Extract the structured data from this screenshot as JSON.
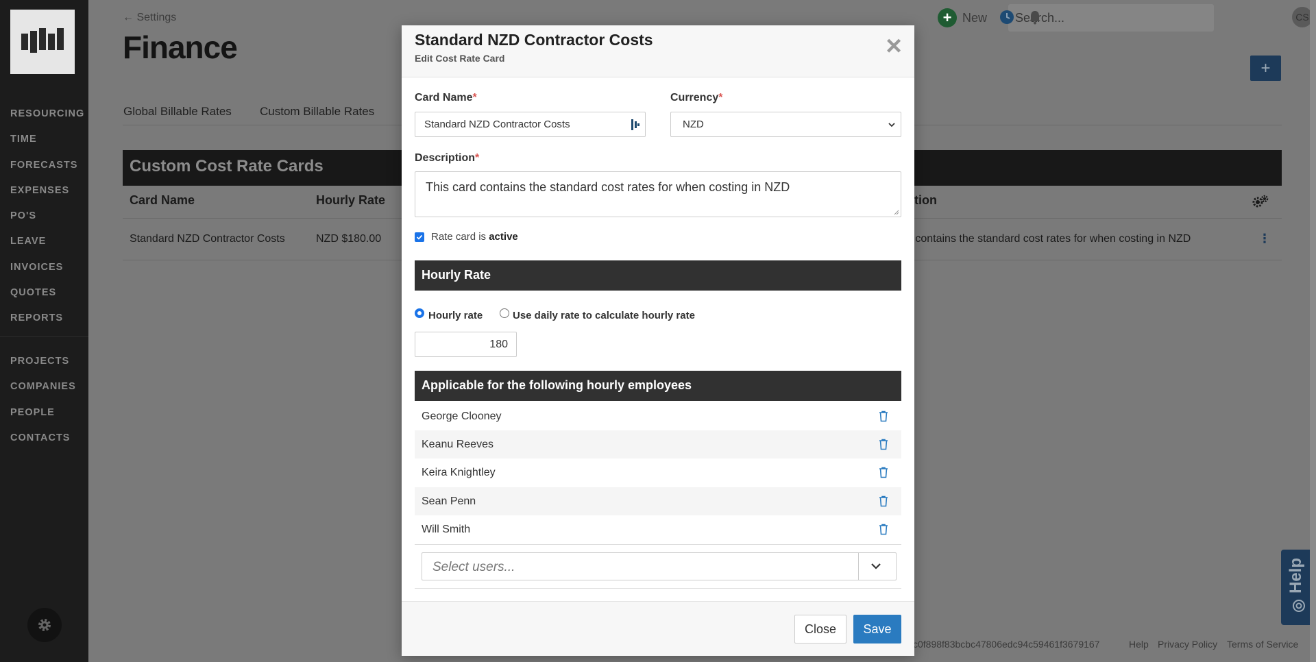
{
  "sidebar": {
    "nav_primary": [
      "RESOURCING",
      "TIME",
      "FORECASTS",
      "EXPENSES",
      "PO'S",
      "LEAVE",
      "INVOICES",
      "QUOTES",
      "REPORTS"
    ],
    "nav_secondary": [
      "PROJECTS",
      "COMPANIES",
      "PEOPLE",
      "CONTACTS"
    ]
  },
  "header": {
    "back_label": "← Settings",
    "page_title": "Finance",
    "new_label": "New",
    "search_placeholder": "Search...",
    "avatar_initials": "CS"
  },
  "tabs": [
    "Global Billable Rates",
    "Custom Billable Rates"
  ],
  "cost_table": {
    "title": "Custom Cost Rate Cards",
    "columns": [
      "Card Name",
      "Hourly Rate",
      "tion"
    ],
    "row": {
      "card_name": "Standard NZD Contractor Costs",
      "hourly_rate": "NZD $180.00",
      "description_fragment": "d contains the standard cost rates for when costing in NZD"
    }
  },
  "footer": {
    "build_hash": "c0f898f83bcbc47806edc94c59461f3679167",
    "help": "Help",
    "privacy": "Privacy Policy",
    "terms": "Terms of Service"
  },
  "help_widget": {
    "label": "Help"
  },
  "modal": {
    "title": "Standard NZD Contractor Costs",
    "subtitle": "Edit Cost Rate Card",
    "card_name_label": "Card Name",
    "card_name_value": "Standard NZD Contractor Costs",
    "currency_label": "Currency",
    "currency_value": "NZD",
    "description_label": "Description",
    "description_value": "This card contains the standard cost rates for when costing in NZD",
    "active_label_prefix": "Rate card is",
    "active_label_bold": "active",
    "hourly_section_title": "Hourly Rate",
    "radio_hourly": "Hourly rate",
    "radio_daily_prefix": "Use daily rate",
    "radio_daily_suffix": "to calculate hourly rate",
    "rate_value": "180",
    "employees_section_title": "Applicable for the following hourly employees",
    "employees": [
      "George Clooney",
      "Keanu Reeves",
      "Keira Knightley",
      "Sean Penn",
      "Will Smith"
    ],
    "select_users_placeholder": "Select users...",
    "close_label": "Close",
    "save_label": "Save"
  }
}
